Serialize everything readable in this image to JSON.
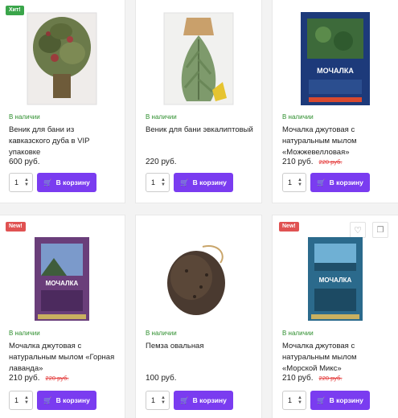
{
  "products": [
    {
      "badge": "Хит!",
      "stock": "В наличии",
      "title": "Веник для бани из кавказского дуба в VIP упаковке",
      "price": "600 руб.",
      "old_price": "",
      "qty": "1",
      "button": "В корзину",
      "image": "oak-broom-image"
    },
    {
      "badge": "",
      "stock": "В наличии",
      "title": "Веник для бани эвкалиптовый",
      "price": "220 руб.",
      "old_price": "",
      "qty": "1",
      "button": "В корзину",
      "image": "eucalyptus-broom-image"
    },
    {
      "badge": "",
      "stock": "В наличии",
      "title": "Мочалка джутовая с натуральным мылом «Можжевелловая»",
      "price": "210 руб.",
      "old_price": "220 руб.",
      "qty": "1",
      "button": "В корзину",
      "image": "juniper-sponge-image",
      "package_text": "МОЧАЛКА"
    },
    {
      "badge": "New!",
      "stock": "В наличии",
      "title": "Мочалка джутовая с натуральным мылом «Горная лаванда»",
      "price": "210 руб.",
      "old_price": "220 руб.",
      "qty": "1",
      "button": "В корзину",
      "image": "lavender-sponge-image",
      "package_text": "МОЧАЛКА"
    },
    {
      "badge": "",
      "stock": "В наличии",
      "title": "Пемза овальная",
      "price": "100 руб.",
      "old_price": "",
      "qty": "1",
      "button": "В корзину",
      "image": "pumice-stone-image"
    },
    {
      "badge": "New!",
      "stock": "В наличии",
      "title": "Мочалка джутовая с натуральным мылом «Морской Микс»",
      "price": "210 руб.",
      "old_price": "220 руб.",
      "qty": "1",
      "button": "В корзину",
      "image": "sea-mix-sponge-image",
      "package_text": "МОЧАЛКА"
    }
  ],
  "colors": {
    "accent": "#7a3cf0",
    "in_stock": "#2f8f2f",
    "badge_hit": "#3aa54a",
    "badge_new": "#e05252",
    "old_price": "#e43b3b"
  }
}
